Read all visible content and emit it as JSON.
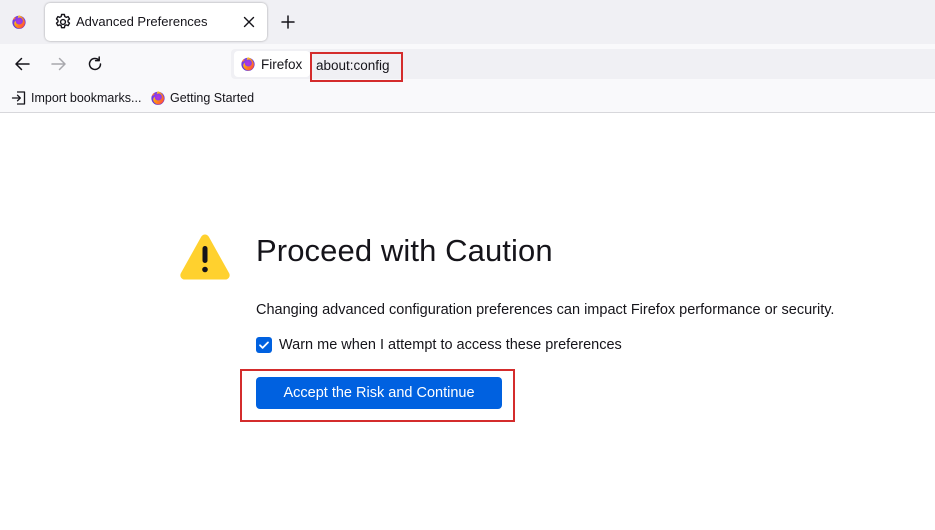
{
  "tabs": [
    {
      "title": "Advanced Preferences",
      "icon": "gear-icon",
      "active": true
    }
  ],
  "navbar": {
    "identity_label": "Firefox",
    "url": "about:config"
  },
  "bookmarks": [
    {
      "label": "Import bookmarks...",
      "icon": "import-icon"
    },
    {
      "label": "Getting Started",
      "icon": "firefox-icon"
    }
  ],
  "content": {
    "heading": "Proceed with Caution",
    "description": "Changing advanced configuration preferences can impact Firefox performance or security.",
    "checkbox_label": "Warn me when I attempt to access these preferences",
    "checkbox_checked": true,
    "accept_label": "Accept the Risk and Continue"
  },
  "colors": {
    "accent": "#0061e0",
    "warning": "#ffd12e",
    "highlight": "#d42c2c",
    "tabstrip_bg": "#f0f0f4"
  }
}
